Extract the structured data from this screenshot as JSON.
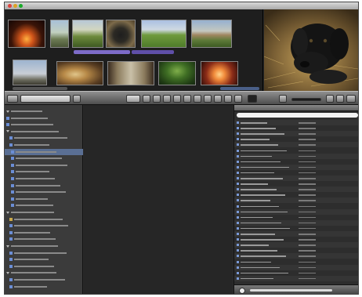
{
  "window": {
    "title": ""
  },
  "colors": {
    "selection": "#5a6f94",
    "chrome_dark": "#2a2a2a",
    "accent_blue": "#6b8ed6",
    "purple_label": "#7d6bc8"
  },
  "thumbnails": [
    {
      "name": "fire-photo"
    },
    {
      "name": "stone-arch-photo"
    },
    {
      "name": "dog-portrait-photo"
    },
    {
      "name": "lawn-photo"
    },
    {
      "name": "estate-house-photo"
    },
    {
      "name": "bare-tree-photo"
    },
    {
      "name": "lion-statue-photo"
    },
    {
      "name": "arched-window-photo"
    },
    {
      "name": "palm-leaves-photo"
    },
    {
      "name": "sunset-glow-photo"
    }
  ],
  "viewer": {
    "subject": "black-dog-portrait"
  },
  "toolbar": {
    "view_label": "",
    "tool_icons": [
      "grid-icon",
      "list-icon",
      "rotate-icon",
      "crop-icon",
      "straighten-icon",
      "redeye-icon",
      "retouch-icon",
      "lift-icon",
      "stamp-icon",
      "adjust-icon",
      "info-icon",
      "fullscreen-icon"
    ]
  },
  "sidebar": {
    "items": [
      {
        "label": "",
        "kind": "tri"
      },
      {
        "label": "",
        "kind": "blue"
      },
      {
        "label": "",
        "kind": "blue"
      },
      {
        "label": "",
        "kind": "tri"
      },
      {
        "label": "",
        "kind": "blue"
      },
      {
        "label": "",
        "kind": "blue"
      },
      {
        "label": "",
        "kind": "blue",
        "selected": true
      },
      {
        "label": "",
        "kind": "blue"
      },
      {
        "label": "",
        "kind": "blue"
      },
      {
        "label": "",
        "kind": "blue"
      },
      {
        "label": "",
        "kind": "blue"
      },
      {
        "label": "",
        "kind": "blue"
      },
      {
        "label": "",
        "kind": "blue"
      },
      {
        "label": "",
        "kind": "blue"
      },
      {
        "label": "",
        "kind": "blue"
      },
      {
        "label": "",
        "kind": "tri"
      },
      {
        "label": "",
        "kind": "flag"
      },
      {
        "label": "",
        "kind": "blue"
      },
      {
        "label": "",
        "kind": "blue"
      },
      {
        "label": "",
        "kind": "blue"
      },
      {
        "label": "",
        "kind": "tri"
      },
      {
        "label": "",
        "kind": "blue"
      },
      {
        "label": "",
        "kind": "blue"
      },
      {
        "label": "",
        "kind": "blue"
      },
      {
        "label": "",
        "kind": "tri"
      },
      {
        "label": "",
        "kind": "blue"
      },
      {
        "label": "",
        "kind": "blue"
      }
    ]
  },
  "center": {
    "empty_title": "",
    "empty_text": ""
  },
  "list": {
    "search_placeholder": "",
    "rows": [
      {
        "name": "",
        "date": ""
      },
      {
        "name": "",
        "date": ""
      },
      {
        "name": "",
        "date": ""
      },
      {
        "name": "",
        "date": ""
      },
      {
        "name": "",
        "date": ""
      },
      {
        "name": "",
        "date": ""
      },
      {
        "name": "",
        "date": ""
      },
      {
        "name": "",
        "date": ""
      },
      {
        "name": "",
        "date": ""
      },
      {
        "name": "",
        "date": ""
      },
      {
        "name": "",
        "date": ""
      },
      {
        "name": "",
        "date": ""
      },
      {
        "name": "",
        "date": ""
      },
      {
        "name": "",
        "date": ""
      },
      {
        "name": "",
        "date": ""
      },
      {
        "name": "",
        "date": ""
      },
      {
        "name": "",
        "date": ""
      },
      {
        "name": "",
        "date": ""
      },
      {
        "name": "",
        "date": ""
      },
      {
        "name": "",
        "date": ""
      },
      {
        "name": "",
        "date": ""
      },
      {
        "name": "",
        "date": ""
      },
      {
        "name": "",
        "date": ""
      },
      {
        "name": "",
        "date": ""
      },
      {
        "name": "",
        "date": ""
      },
      {
        "name": "",
        "date": ""
      },
      {
        "name": "",
        "date": ""
      },
      {
        "name": "",
        "date": ""
      },
      {
        "name": "",
        "date": ""
      }
    ]
  }
}
